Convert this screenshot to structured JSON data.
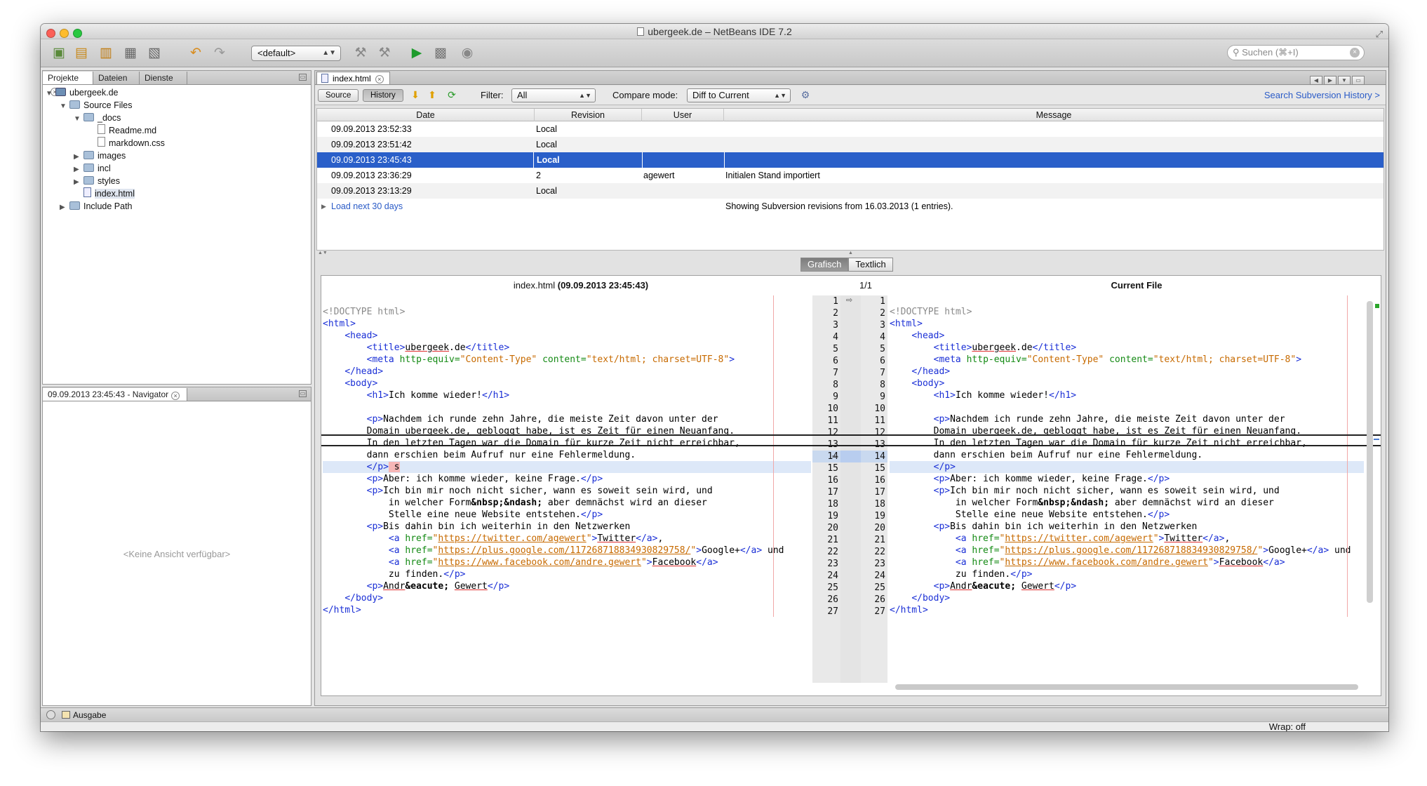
{
  "window": {
    "title": "ubergeek.de – NetBeans IDE 7.2"
  },
  "toolbar": {
    "config_value": "<default>",
    "search_placeholder": "Suchen (⌘+I)"
  },
  "left_tabs": [
    {
      "label": "Projekte"
    },
    {
      "label": "Dateien"
    },
    {
      "label": "Dienste"
    }
  ],
  "tree": [
    "ubergeek.de",
    "Source Files",
    "_docs",
    "Readme.md",
    "markdown.css",
    "images",
    "incl",
    "styles",
    "index.html",
    "Include Path"
  ],
  "navigator": {
    "title": "09.09.2013 23:45:43 - Navigator",
    "empty": "<Keine Ansicht verfügbar>"
  },
  "bottom": {
    "output": "Ausgabe",
    "wrap": "Wrap: off"
  },
  "editor": {
    "tab": "index.html",
    "source_btn": "Source",
    "history_btn": "History",
    "filter_label": "Filter:",
    "filter_value": "All",
    "compare_label": "Compare mode:",
    "compare_value": "Diff to Current",
    "search_history": "Search Subversion History >"
  },
  "history": {
    "headers": [
      "Date",
      "Revision",
      "User",
      "Message"
    ],
    "rows": [
      {
        "date": "09.09.2013 23:52:33",
        "revision": "Local",
        "user": "",
        "message": ""
      },
      {
        "date": "09.09.2013 23:51:42",
        "revision": "Local",
        "user": "",
        "message": ""
      },
      {
        "date": "09.09.2013 23:45:43",
        "revision": "Local",
        "user": "",
        "message": ""
      },
      {
        "date": "09.09.2013 23:36:29",
        "revision": "2",
        "user": "agewert",
        "message": "Initialen Stand importiert"
      },
      {
        "date": "09.09.2013 23:13:29",
        "revision": "Local",
        "user": "",
        "message": ""
      }
    ],
    "load_more": "Load next 30 days",
    "info": "Showing Subversion revisions from 16.03.2013 (1 entries)."
  },
  "diff": {
    "grafisch": "Grafisch",
    "textlich": "Textlich",
    "left_title_prefix": "index.html ",
    "left_title_date": "(09.09.2013 23:45:43)",
    "counter": "1/1",
    "right_title": "Current File"
  }
}
